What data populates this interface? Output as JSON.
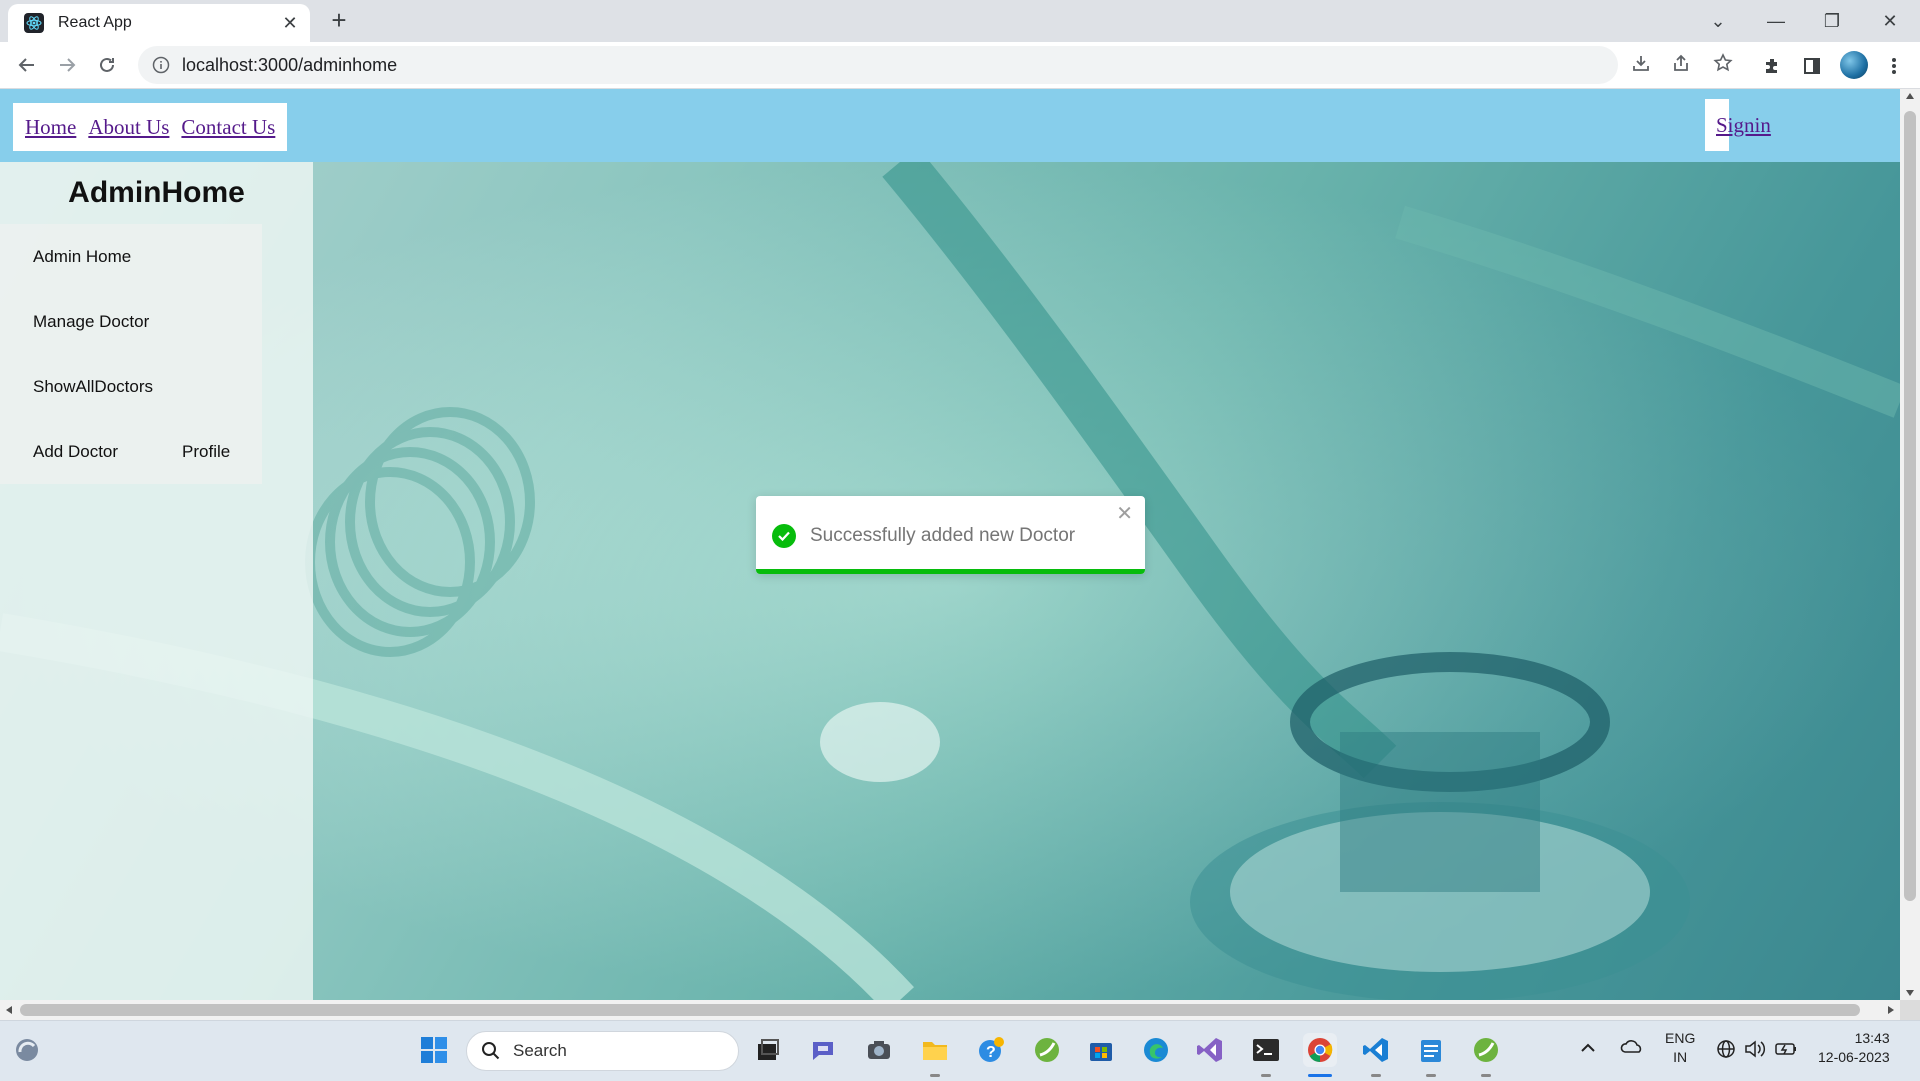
{
  "browser": {
    "tab_title": "React App",
    "url": "localhost:3000/adminhome"
  },
  "nav": {
    "links": [
      "Home",
      "About Us",
      "Contact Us"
    ],
    "signin": "Signin"
  },
  "sidebar": {
    "title": "AdminHome",
    "items": [
      "Admin Home",
      "Manage Doctor",
      "ShowAllDoctors",
      "Add Doctor",
      "Profile"
    ]
  },
  "toast": {
    "message": "Successfully added new Doctor",
    "type": "success",
    "color": "#07bc0c"
  },
  "taskbar": {
    "search_placeholder": "Search",
    "lang": "ENG",
    "region": "IN",
    "time": "13:43",
    "date": "12-06-2023"
  },
  "colors": {
    "nav_bg": "#87ceeb",
    "link": "#551a8b"
  }
}
